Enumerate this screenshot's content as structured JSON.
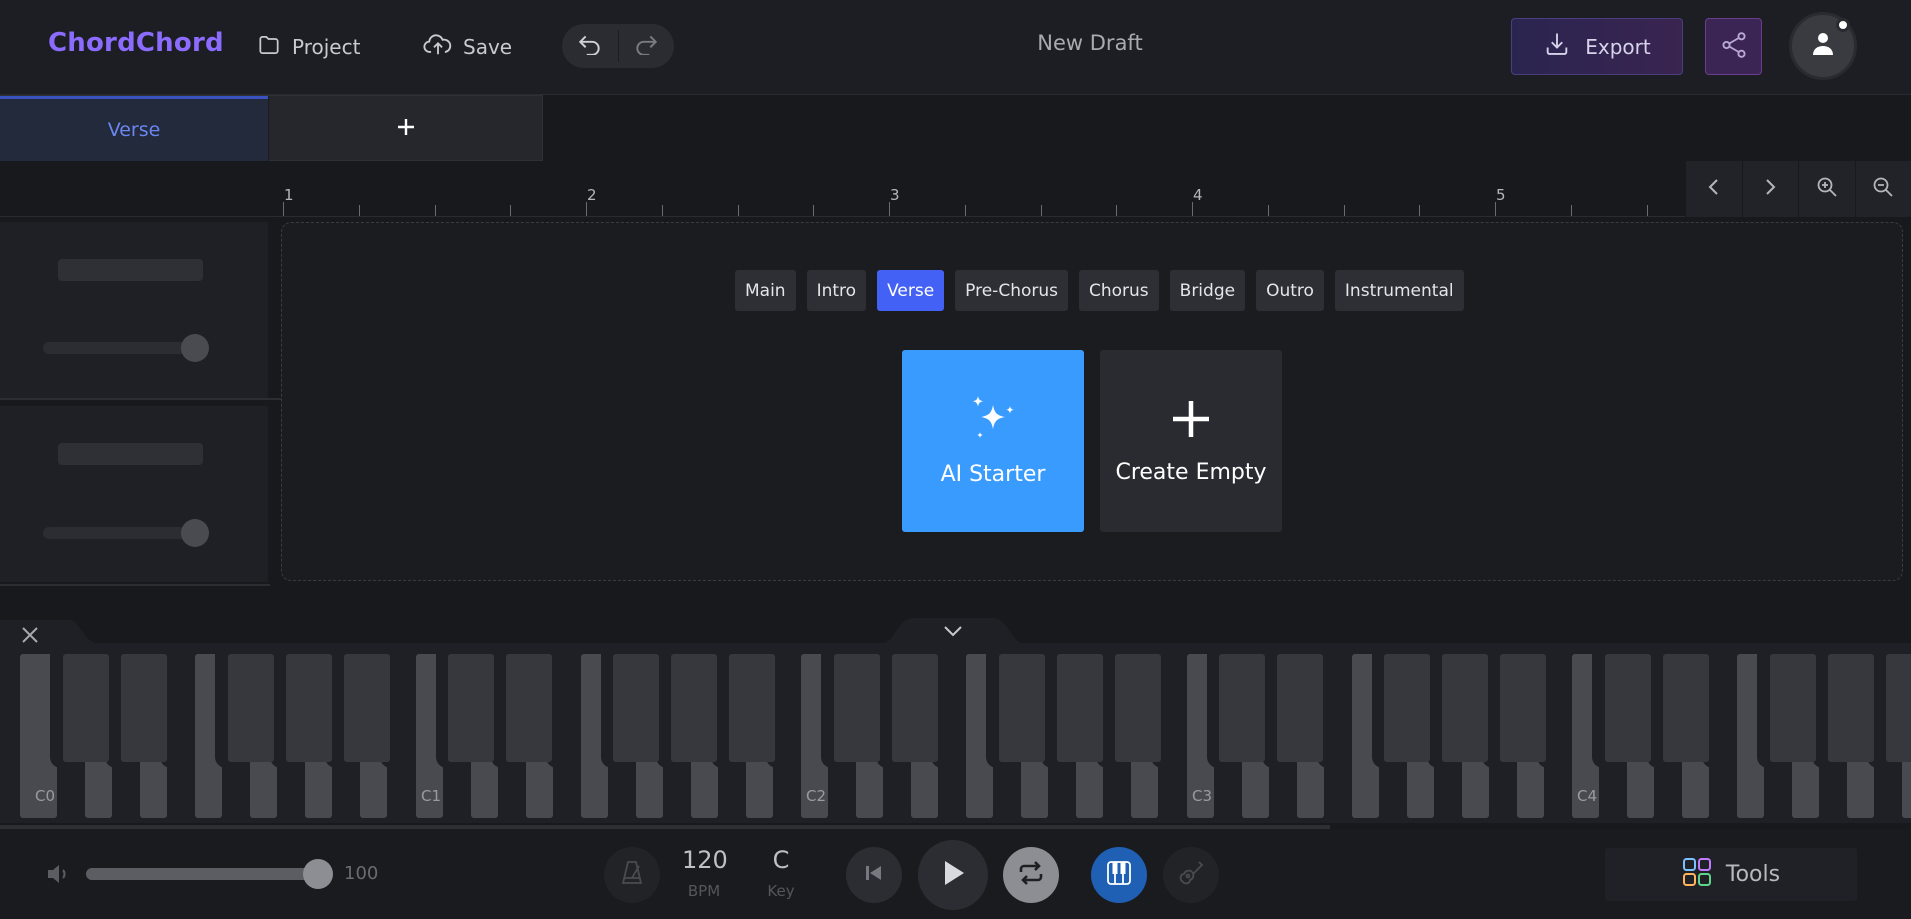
{
  "header": {
    "logo": "ChordChord",
    "project_label": "Project",
    "save_label": "Save",
    "title": "New Draft",
    "export_label": "Export"
  },
  "section_tabs": {
    "items": [
      {
        "label": "Verse",
        "active": true
      }
    ],
    "add_label": "+"
  },
  "timeline": {
    "bars": [
      "1",
      "2",
      "3",
      "4",
      "5"
    ]
  },
  "canvas": {
    "sections": [
      {
        "label": "Main",
        "active": false
      },
      {
        "label": "Intro",
        "active": false
      },
      {
        "label": "Verse",
        "active": true
      },
      {
        "label": "Pre-Chorus",
        "active": false
      },
      {
        "label": "Chorus",
        "active": false
      },
      {
        "label": "Bridge",
        "active": false
      },
      {
        "label": "Outro",
        "active": false
      },
      {
        "label": "Instrumental",
        "active": false
      }
    ],
    "ai_starter_label": "AI Starter",
    "create_empty_label": "Create Empty"
  },
  "piano": {
    "octave_labels": [
      "C0",
      "C1",
      "C2",
      "C3",
      "C4"
    ]
  },
  "transport": {
    "volume_value": "100",
    "volume_level": 1.0,
    "bpm_value": "120",
    "bpm_label": "BPM",
    "key_value": "C",
    "key_label": "Key",
    "tools_label": "Tools"
  },
  "colors": {
    "accent": "#4461f5",
    "logo": "#8b6cff",
    "ai_card": "#3a9bff",
    "piano_mode": "#1f5fb4"
  }
}
